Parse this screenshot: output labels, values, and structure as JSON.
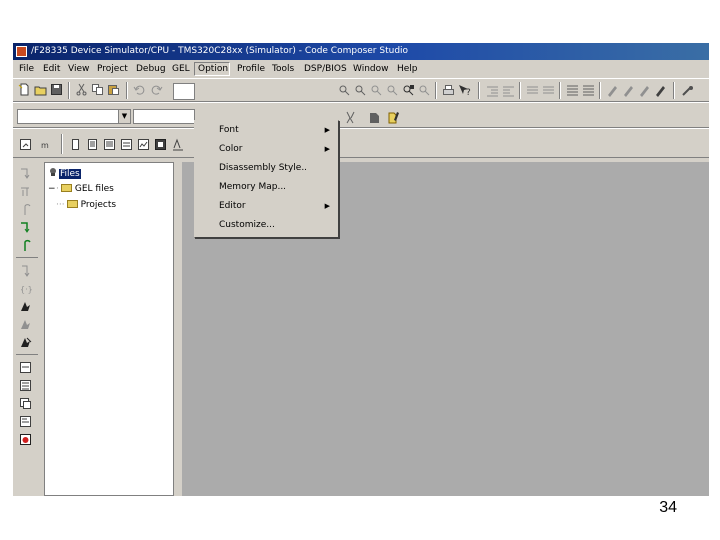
{
  "window": {
    "title": "/F28335 Device Simulator/CPU - TMS320C28xx (Simulator) - Code Composer Studio"
  },
  "menubar": {
    "items": [
      {
        "label": "File"
      },
      {
        "label": "Edit"
      },
      {
        "label": "View"
      },
      {
        "label": "Project"
      },
      {
        "label": "Debug"
      },
      {
        "label": "GEL"
      },
      {
        "label": "Option",
        "active": true
      },
      {
        "label": "Profile"
      },
      {
        "label": "Tools"
      },
      {
        "label": "DSP/BIOS"
      },
      {
        "label": "Window"
      },
      {
        "label": "Help"
      }
    ]
  },
  "option_menu": {
    "items": [
      {
        "label": "Font",
        "submenu": true
      },
      {
        "label": "Color",
        "submenu": true
      },
      {
        "label": "Disassembly Style..",
        "submenu": false
      },
      {
        "label": "Memory Map...",
        "submenu": false
      },
      {
        "label": "Editor",
        "submenu": true
      },
      {
        "label": "Customize...",
        "submenu": false
      }
    ],
    "submenu_glyph": "▶"
  },
  "file_tree": {
    "root": "Files",
    "expander": "−",
    "children": [
      "GEL files",
      "Projects"
    ]
  },
  "slide": {
    "page_number": "34"
  },
  "icons": {
    "toolbar1": [
      "new-file-icon",
      "open-file-icon",
      "save-icon",
      "cut-icon",
      "copy-icon",
      "paste-icon",
      "undo-icon",
      "redo-icon"
    ],
    "toolbar_left_strip": [
      "step-into-icon",
      "step-over-icon",
      "step-out-icon",
      "run-to-cursor-icon",
      "set-pc-icon",
      "assembly-step-into-icon",
      "assembly-step-over-icon",
      "run-icon",
      "halt-icon",
      "animate-icon",
      "watch-window-icon",
      "memory-window-icon",
      "register-icon",
      "disassembly-icon",
      "stop-icon"
    ]
  },
  "colors": {
    "titlebar": "#0a246a",
    "chrome": "#d4d0c8",
    "workspace": "#ababab",
    "selection": "#0a246a"
  }
}
